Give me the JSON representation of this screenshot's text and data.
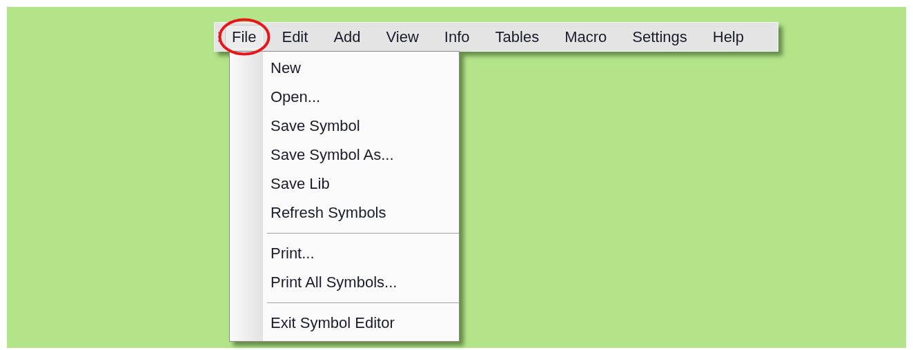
{
  "menu_bar": {
    "items": [
      {
        "label": "File",
        "selected": true,
        "highlighted": true
      },
      {
        "label": "Edit",
        "selected": false,
        "highlighted": false
      },
      {
        "label": "Add",
        "selected": false,
        "highlighted": false
      },
      {
        "label": "View",
        "selected": false,
        "highlighted": false
      },
      {
        "label": "Info",
        "selected": false,
        "highlighted": false
      },
      {
        "label": "Tables",
        "selected": false,
        "highlighted": false
      },
      {
        "label": "Macro",
        "selected": false,
        "highlighted": false
      },
      {
        "label": "Settings",
        "selected": false,
        "highlighted": false
      },
      {
        "label": "Help",
        "selected": false,
        "highlighted": false
      }
    ]
  },
  "file_menu": {
    "items": [
      {
        "kind": "item",
        "label": "New"
      },
      {
        "kind": "item",
        "label": "Open..."
      },
      {
        "kind": "item",
        "label": "Save Symbol"
      },
      {
        "kind": "item",
        "label": "Save Symbol As..."
      },
      {
        "kind": "item",
        "label": "Save Lib"
      },
      {
        "kind": "item",
        "label": "Refresh Symbols"
      },
      {
        "kind": "separator"
      },
      {
        "kind": "item",
        "label": "Print..."
      },
      {
        "kind": "item",
        "label": "Print All Symbols..."
      },
      {
        "kind": "separator"
      },
      {
        "kind": "item",
        "label": "Exit Symbol Editor"
      }
    ]
  }
}
